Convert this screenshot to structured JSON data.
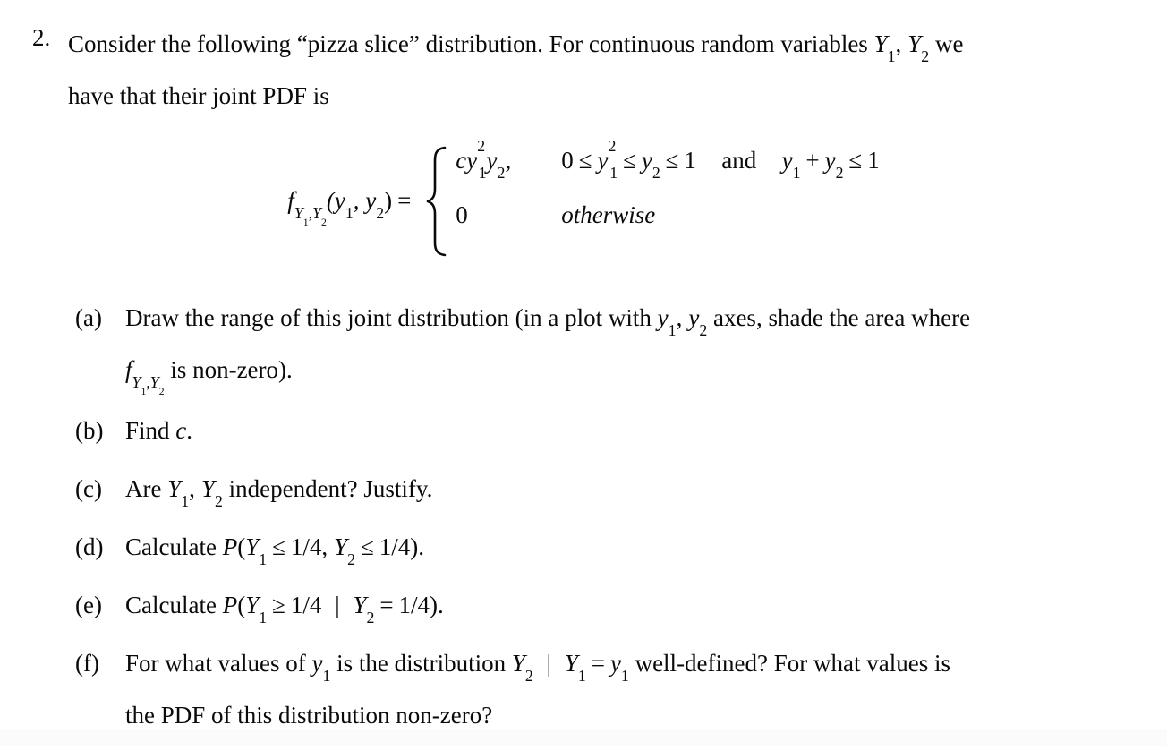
{
  "document": {
    "type": "math-homework-problem",
    "background_color": "#ffffff",
    "text_color": "#0a0a0a"
  },
  "problem": {
    "number": "2.",
    "line1_pre": "Consider the following “pizza slice” distribution. For continuous random variables ",
    "line1_var1": "Y",
    "line1_var1_sub": "1",
    "line1_comma": ",",
    "line1_var2": "Y",
    "line1_var2_sub": "2",
    "line1_post": " we",
    "line2": "have that their joint PDF is"
  },
  "equation": {
    "lhs_f": "f",
    "lhs_sub_y1": "Y",
    "lhs_sub_y1_num": "1",
    "lhs_sub_comma": ",",
    "lhs_sub_y2": "Y",
    "lhs_sub_y2_num": "2",
    "lhs_args": "(y",
    "lhs_arg1_sub": "1",
    "lhs_arg_comma": ", y",
    "lhs_arg2_sub": "2",
    "lhs_close": ")",
    "equals": "=",
    "brace": "left-curly-brace",
    "case1_value_c": "cy",
    "case1_value_y1_exp": "2",
    "case1_value_y1_sub": "1",
    "case1_value_y2": "y",
    "case1_value_y2_sub": "2",
    "case1_value_comma": ",",
    "case1_cond_zero": "0",
    "case1_cond_le1": "≤",
    "case1_cond_y1": "y",
    "case1_cond_y1_sub": "1",
    "case1_cond_y1_exp": "2",
    "case1_cond_le2": "≤",
    "case1_cond_y2": "y",
    "case1_cond_y2_sub": "2",
    "case1_cond_le3": "≤",
    "case1_cond_one": "1",
    "case1_cond_and": "and",
    "case1_cond2_y1": "y",
    "case1_cond2_y1_sub": "1",
    "case1_cond2_plus": "+",
    "case1_cond2_y2": "y",
    "case1_cond2_y2_sub": "2",
    "case1_cond2_le": "≤",
    "case1_cond2_one": "1",
    "case2_value": "0",
    "case2_cond": "otherwise"
  },
  "items": [
    {
      "label": "(a)",
      "line1_pre": "Draw the range of this joint distribution (in a plot with ",
      "line1_y1": "y",
      "line1_y1_sub": "1",
      "line1_comma": ",",
      "line1_y2": "y",
      "line1_y2_sub": "2",
      "line1_post": " axes, shade the area where",
      "line2_f": "f",
      "line2_sub_y1": "Y",
      "line2_sub_y1_num": "1",
      "line2_sub_comma": ",",
      "line2_sub_y2": "Y",
      "line2_sub_y2_num": "2",
      "line2_post": " is non-zero)."
    },
    {
      "label": "(b)",
      "line1_pre": "Find ",
      "line1_c": "c",
      "line1_post": "."
    },
    {
      "label": "(c)",
      "line1_pre": "Are ",
      "line1_Y1": "Y",
      "line1_Y1_sub": "1",
      "line1_comma": ",",
      "line1_Y2": "Y",
      "line1_Y2_sub": "2",
      "line1_post": " independent?  Justify."
    },
    {
      "label": "(d)",
      "line1_pre": "Calculate ",
      "line1_P": "P",
      "line1_open": "(",
      "line1_Y1": "Y",
      "line1_Y1_sub": "1",
      "line1_le1": "≤",
      "line1_frac1": "1/4",
      "line1_comma": ",",
      "line1_Y2": "Y",
      "line1_Y2_sub": "2",
      "line1_le2": "≤",
      "line1_frac2": "1/4",
      "line1_close": ")."
    },
    {
      "label": "(e)",
      "line1_pre": "Calculate ",
      "line1_P": "P",
      "line1_open": "(",
      "line1_Y1": "Y",
      "line1_Y1_sub": "1",
      "line1_ge": "≥",
      "line1_frac1": "1/4",
      "line1_bar": "|",
      "line1_Y2": "Y",
      "line1_Y2_sub": "2",
      "line1_eq": "=",
      "line1_frac2": "1/4",
      "line1_close": ")."
    },
    {
      "label": "(f)",
      "line1_pre": "For what values of ",
      "line1_y1": "y",
      "line1_y1_sub": "1",
      "line1_mid": " is the distribution ",
      "line1_Y2": "Y",
      "line1_Y2_sub": "2",
      "line1_bar": "|",
      "line1_Y1": "Y",
      "line1_Y1_sub": "1",
      "line1_eq": "=",
      "line1_y1b": "y",
      "line1_y1b_sub": "1",
      "line1_post": " well-defined?  For what values is",
      "line2": "the PDF of this distribution non-zero?"
    }
  ]
}
